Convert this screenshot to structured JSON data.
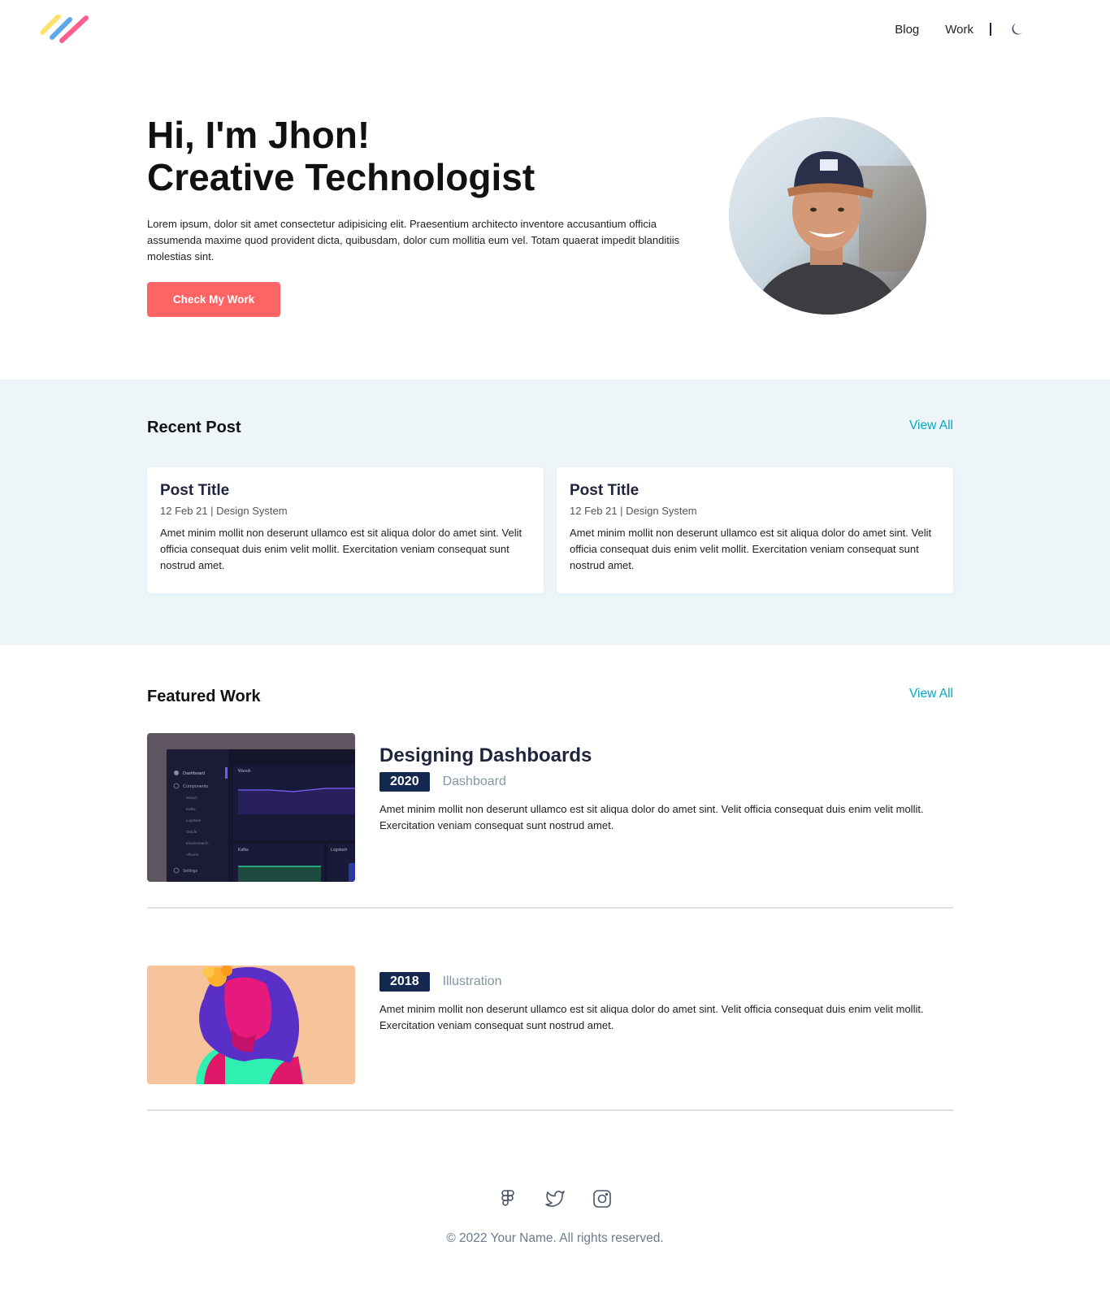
{
  "nav": {
    "blog_label": "Blog",
    "work_label": "Work",
    "theme_icon": "moon-icon"
  },
  "hero": {
    "line1": "Hi, I'm Jhon!",
    "line2": "Creative Technologist",
    "description": "Lorem ipsum, dolor sit amet consectetur adipisicing elit. Praesentium architecto inventore accusantium officia assumenda maxime quod provident dicta, quibusdam, dolor cum mollitia eum vel. Totam quaerat impedit blanditiis molestias sint.",
    "cta_label": "Check My Work"
  },
  "recent_posts": {
    "title": "Recent Post",
    "view_all": "View All",
    "posts": [
      {
        "title": "Post Title",
        "meta": "12 Feb 21 | Design System",
        "body": "Amet minim mollit non deserunt ullamco est sit aliqua dolor do amet sint. Velit officia consequat duis enim velit mollit. Exercitation veniam consequat sunt nostrud amet."
      },
      {
        "title": "Post Title",
        "meta": "12 Feb 21 | Design System",
        "body": "Amet minim mollit non deserunt ullamco est sit aliqua dolor do amet sint. Velit officia consequat duis enim velit mollit. Exercitation veniam consequat sunt nostrud amet."
      }
    ]
  },
  "featured_work": {
    "title": "Featured Work",
    "view_all": "View All",
    "items": [
      {
        "heading": "Designing Dashboards",
        "year": "2020",
        "category": "Dashboard",
        "description": "Amet minim mollit non deserunt ullamco est sit aliqua dolor do amet sint. Velit officia consequat duis enim velit mollit. Exercitation veniam consequat sunt nostrud amet.",
        "thumb_labels": [
          "Dashboard",
          "Components",
          "Wasuh",
          "Kafka",
          "Logstash",
          "Oracle",
          "ElasticSearch",
          "Albums",
          "Settings"
        ],
        "chart_labels": [
          "Wasuh",
          "Kafka",
          "Logstash"
        ]
      },
      {
        "year": "2018",
        "category": "Illustration",
        "description": "Amet minim mollit non deserunt ullamco est sit aliqua dolor do amet sint. Velit officia consequat duis enim velit mollit. Exercitation veniam consequat sunt nostrud amet."
      }
    ]
  },
  "footer": {
    "social_icons": [
      "figma-icon",
      "twitter-icon",
      "instagram-icon"
    ],
    "copyright": "© 2022 Your Name. All rights reserved."
  },
  "colors": {
    "accent": "#ff6464",
    "link": "#00a8cc",
    "badge": "#142850",
    "section_bg": "#edf5f8"
  }
}
